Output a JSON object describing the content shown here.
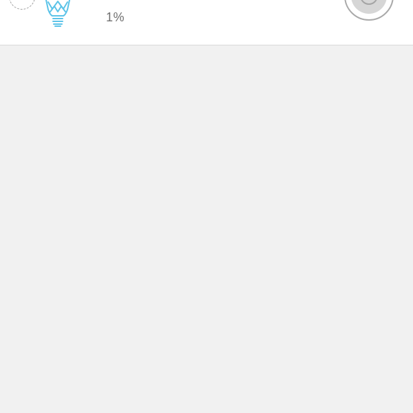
{
  "device": {
    "brightness_label": "1%",
    "brightness_value": 1,
    "bulb_color": "#5bc3e8"
  },
  "icons": {
    "select": "dashed-circle-icon",
    "device": "light-bulb-icon",
    "power": "power-button-icon"
  },
  "colors": {
    "header_bg": "#ffffff",
    "content_bg": "#f1f1f1",
    "accent": "#5bc3e8",
    "text_secondary": "#6f6f6f"
  }
}
